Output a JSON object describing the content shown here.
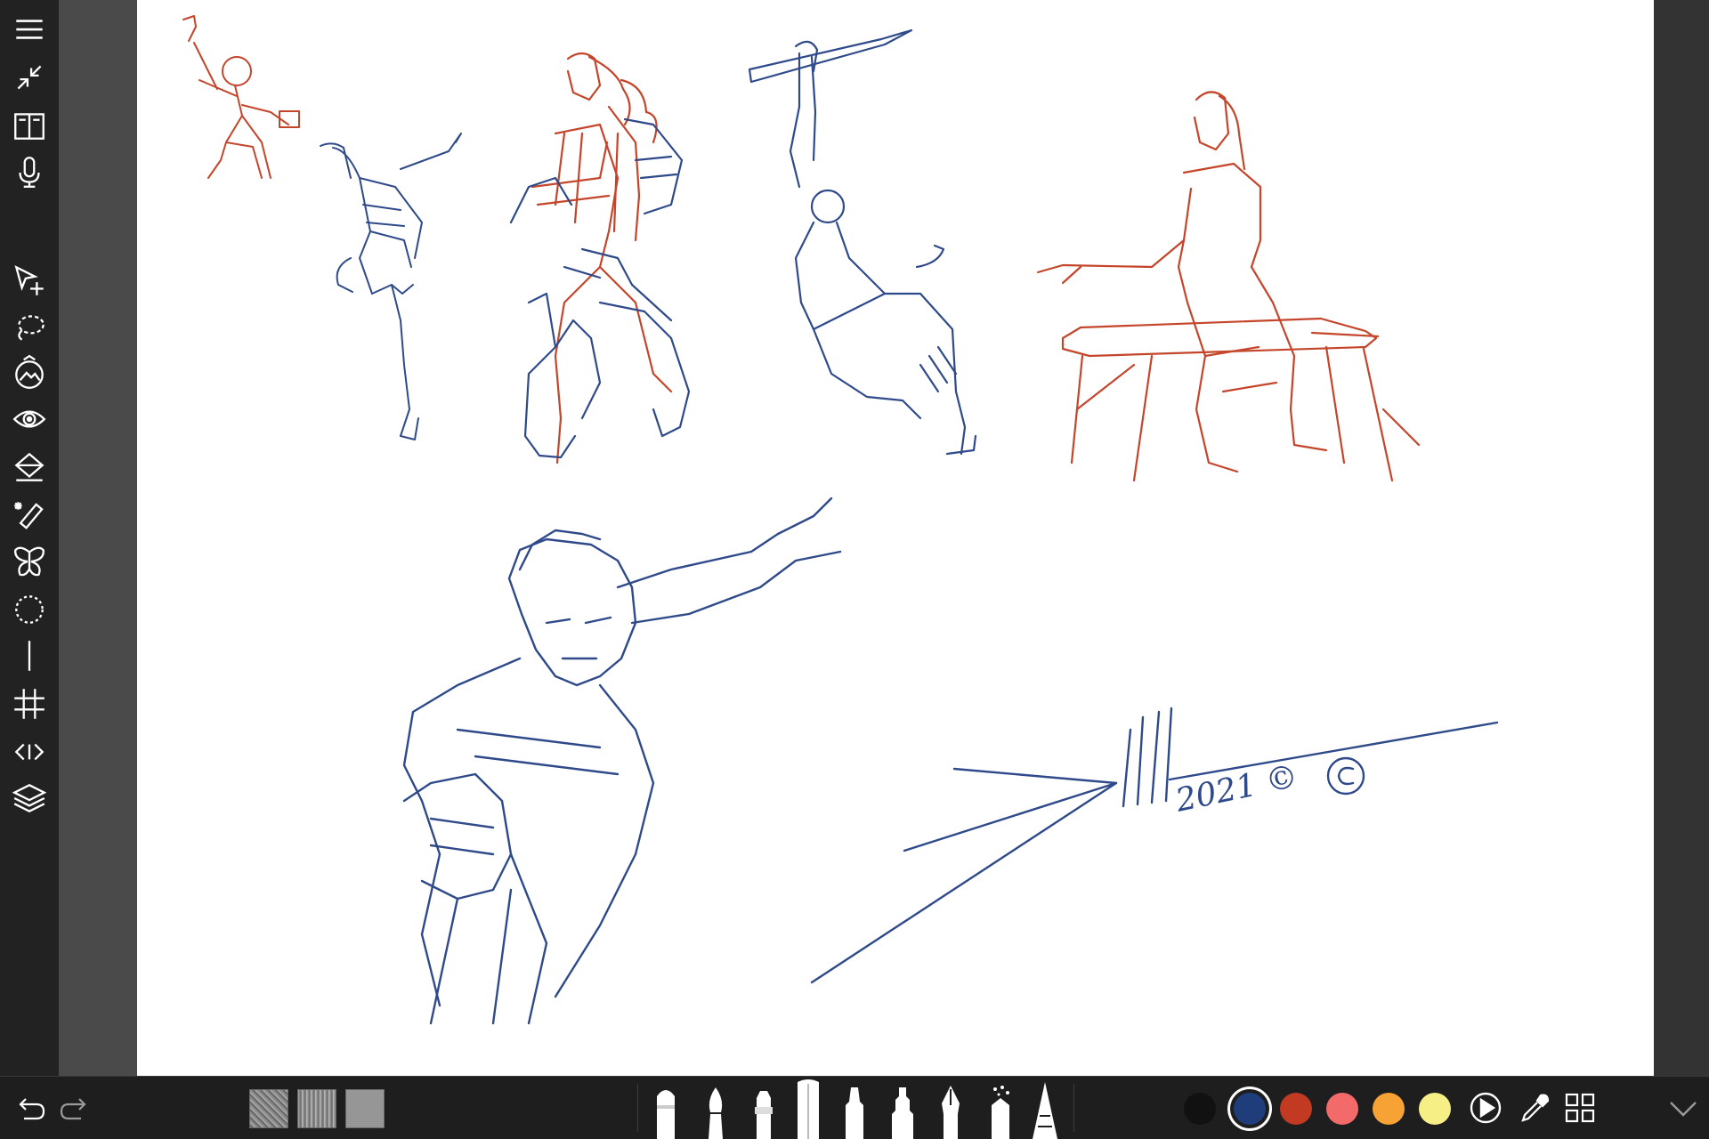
{
  "app": {
    "signature": "2021 ©"
  },
  "toolbar_left": [
    {
      "name": "menu-icon"
    },
    {
      "name": "collapse-icon"
    },
    {
      "name": "gallery-book-icon"
    },
    {
      "name": "microphone-icon"
    },
    {
      "name": "transform-icon"
    },
    {
      "name": "lasso-select-icon"
    },
    {
      "name": "import-image-icon"
    },
    {
      "name": "eye-visibility-icon"
    },
    {
      "name": "fill-bucket-icon"
    },
    {
      "name": "magic-wand-icon"
    },
    {
      "name": "symmetry-butterfly-icon"
    },
    {
      "name": "ellipse-guide-icon"
    },
    {
      "name": "line-guide-icon"
    },
    {
      "name": "grid-guide-icon"
    },
    {
      "name": "perspective-guide-icon"
    },
    {
      "name": "layers-icon"
    }
  ],
  "bottom_bar": {
    "undo": "undo-icon",
    "redo": "redo-icon",
    "textures": [
      "texture-rough",
      "texture-woven",
      "texture-grain"
    ],
    "brushes": [
      "pencil",
      "paintbrush",
      "airbrush",
      "ruler",
      "marker",
      "felt-tip",
      "ink-pen",
      "spray",
      "cone-pencil"
    ],
    "colors": [
      {
        "name": "black",
        "hex": "#111111"
      },
      {
        "name": "navy",
        "hex": "#1f3d7a",
        "selected": true
      },
      {
        "name": "rust-red",
        "hex": "#c23a22"
      },
      {
        "name": "salmon",
        "hex": "#f26a6a"
      },
      {
        "name": "orange",
        "hex": "#f7a234"
      },
      {
        "name": "yellow",
        "hex": "#f5ef86"
      }
    ]
  },
  "colors": {
    "ink_blue": "#2f4a8a",
    "ink_red": "#c5452b"
  }
}
